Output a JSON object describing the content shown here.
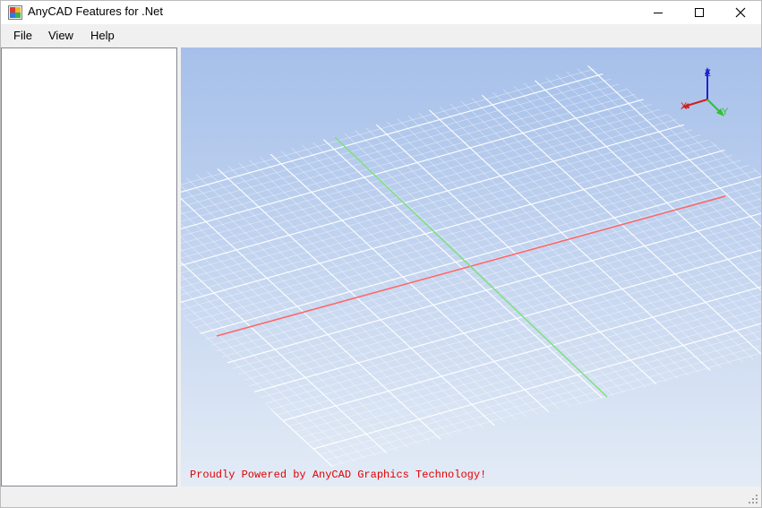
{
  "window": {
    "title": "AnyCAD Features for .Net",
    "icon": "app-icon",
    "controls": [
      "minimize-icon",
      "maximize-icon",
      "close-icon"
    ]
  },
  "menu": {
    "items": [
      {
        "label": "File"
      },
      {
        "label": "View"
      },
      {
        "label": "Help"
      }
    ]
  },
  "viewport": {
    "credit_text": "Proudly Powered by AnyCAD Graphics Technology!",
    "credit_color": "#e00000",
    "background_top": "#a6c0ea",
    "background_bottom": "#e3ebf6",
    "grid_color": "#ffffff",
    "x_axis_color": "#ff6666",
    "y_axis_color": "#7ee07e",
    "triad": {
      "z_label": "Z",
      "x_label": "X",
      "y_label": "Y",
      "z_color": "#2020d0",
      "x_color": "#d02020",
      "y_color": "#30c030"
    }
  }
}
